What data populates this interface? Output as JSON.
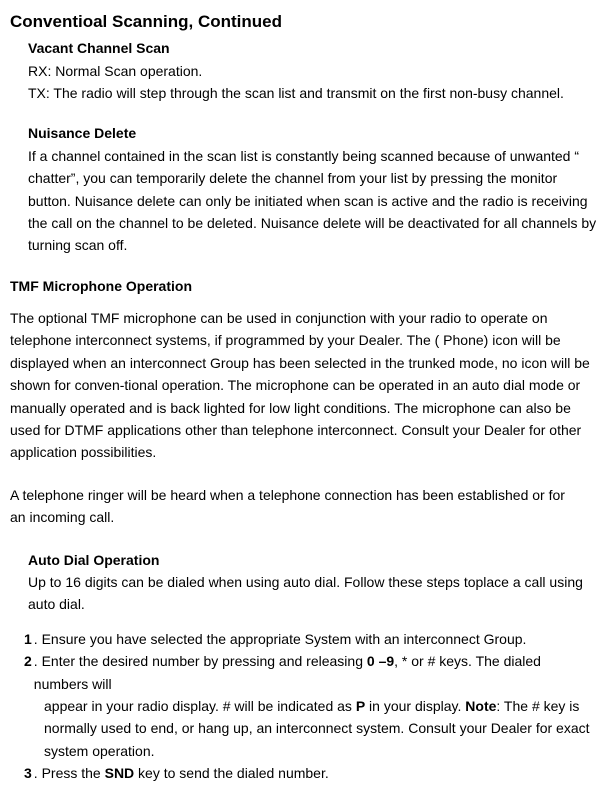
{
  "title": "Conventioal Scanning, Continued",
  "vacant": {
    "heading": "Vacant Channel Scan",
    "rx": "RX: Normal Scan operation.",
    "tx": "TX: The radio will step through the scan list and transmit on the first non-busy channel."
  },
  "nuisance": {
    "heading": "Nuisance Delete",
    "body": "If a channel contained in the scan list is constantly being scanned because of unwanted “ chatter”, you can temporarily delete the channel from your list by pressing the monitor button. Nuisance delete can only be initiated when scan is active and the radio is receiving the call on the channel to be deleted. Nuisance delete will be deactivated for all channels by turning scan off."
  },
  "tmf": {
    "heading": "TMF Microphone Operation",
    "p1": "The optional TMF microphone can be used in conjunction with your radio to operate on telephone interconnect systems, if programmed by your Dealer. The ( Phone) icon will be displayed when an interconnect Group has been selected in the trunked mode, no icon will be shown for conven-tional operation. The microphone can be operated in an auto dial mode or manually operated and is back lighted for low light conditions. The microphone can also be used for DTMF applications other than telephone interconnect. Consult your Dealer for other application possibilities.",
    "p2a": "A telephone ringer will be heard when a telephone connection has been established or for",
    "p2b": "an incoming call."
  },
  "autodial": {
    "heading": "Auto Dial Operation",
    "intro": "Up to 16 digits can be dialed when using auto dial. Follow these steps toplace a call using auto dial.",
    "steps": {
      "n1": "1",
      "t1": ". Ensure you have selected the appropriate System with an interconnect Group.",
      "n2": "2",
      "t2a": ". Enter the desired number by pressing and releasing ",
      "t2b": "0 –9",
      "t2c": ", * or # keys. The dialed numbers will",
      "t2d": "appear in your radio display. # will be indicated as ",
      "t2e": "P",
      "t2f": " in your display. ",
      "t2g": "Note",
      "t2h": ": The # key is",
      "t2i": "normally used to end, or hang up, an interconnect system. Consult your Dealer for exact",
      "t2j": "system operation.",
      "n3": "3",
      "t3a": ". Press the ",
      "t3b": "SND",
      "t3c": " key to send the dialed number."
    }
  }
}
